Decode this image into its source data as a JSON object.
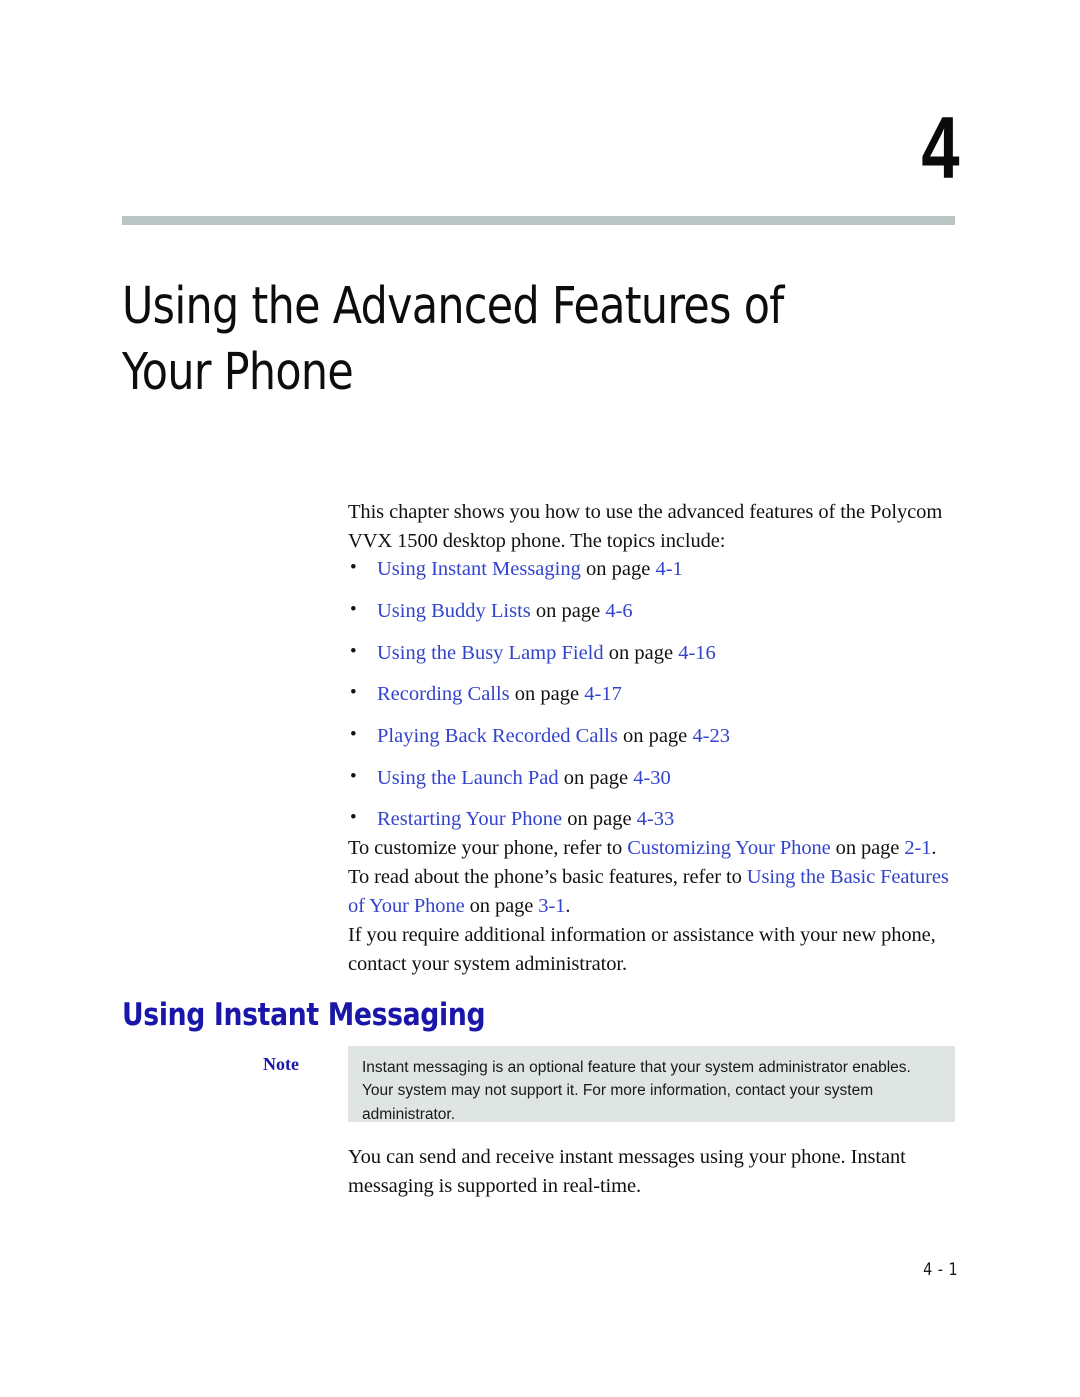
{
  "chapter": {
    "number": "4",
    "title": "Using the Advanced Features of Your Phone"
  },
  "intro": {
    "paragraph": "This chapter shows you how to use the advanced features of the Polycom VVX 1500 desktop phone. The topics include:"
  },
  "topics": [
    {
      "link": "Using Instant Messaging",
      "connector": " on page ",
      "page": "4-1"
    },
    {
      "link": "Using Buddy Lists",
      "connector": " on page ",
      "page": "4-6"
    },
    {
      "link": "Using the Busy Lamp Field",
      "connector": " on page ",
      "page": "4-16"
    },
    {
      "link": "Recording Calls",
      "connector": " on page ",
      "page": "4-17"
    },
    {
      "link": "Playing Back Recorded Calls",
      "connector": " on page ",
      "page": "4-23"
    },
    {
      "link": "Using the Launch Pad",
      "connector": " on page ",
      "page": "4-30"
    },
    {
      "link": "Restarting Your Phone",
      "connector": " on page ",
      "page": "4-33"
    }
  ],
  "customize_paragraph": {
    "part1": "To customize your phone, refer to ",
    "link1": "Customizing Your Phone",
    "part2": " on page ",
    "page1": "2-1",
    "part3": ". To read about the phone’s basic features, refer to ",
    "link2": "Using the Basic Features of Your Phone",
    "part4": " on page ",
    "page2": "3-1",
    "part5": "."
  },
  "assistance_paragraph": "If you require additional information or assistance with your new phone, contact your system administrator.",
  "section": {
    "heading": "Using Instant Messaging"
  },
  "note": {
    "label": "Note",
    "text": "Instant messaging is an optional feature that your system administrator enables. Your system may not support it. For more information, contact your system administrator."
  },
  "closing_paragraph": "You can send and receive instant messages using your phone. Instant messaging is supported in real-time.",
  "footer": {
    "page_number": "4 - 1"
  },
  "colors": {
    "link_blue": "#3344cc",
    "heading_blue": "#1a16aa",
    "rule_gray": "#b9c6c4",
    "note_background": "#dee5e3",
    "body_text": "#111111"
  }
}
